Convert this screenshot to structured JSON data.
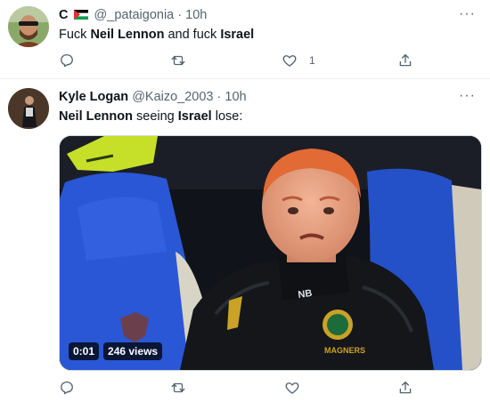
{
  "tweet1": {
    "name": "C",
    "handle": "@_pataigonia",
    "sep": "·",
    "time": "10h",
    "more": "···",
    "text": [
      {
        "t": "Fuck ",
        "b": false
      },
      {
        "t": "Neil Lennon",
        "b": true
      },
      {
        "t": " and fuck ",
        "b": false
      },
      {
        "t": "Israel",
        "b": true
      }
    ],
    "like_count": "1",
    "icons": [
      "reply-icon",
      "retweet-icon",
      "like-icon",
      "share-icon"
    ]
  },
  "tweet2": {
    "name": "Kyle Logan",
    "handle": "@Kaizo_2003",
    "sep": "·",
    "time": "10h",
    "more": "···",
    "text": [
      {
        "t": "Neil Lennon",
        "b": true
      },
      {
        "t": " seeing ",
        "b": false
      },
      {
        "t": "Israel",
        "b": true
      },
      {
        "t": " lose:",
        "b": false
      }
    ],
    "video": {
      "duration": "0:01",
      "views": "246 views"
    },
    "icons": [
      "reply-icon",
      "retweet-icon",
      "like-icon",
      "share-icon"
    ]
  },
  "colors": {
    "muted": "#536471",
    "divider": "#eff3f4",
    "text": "#0f1419"
  }
}
